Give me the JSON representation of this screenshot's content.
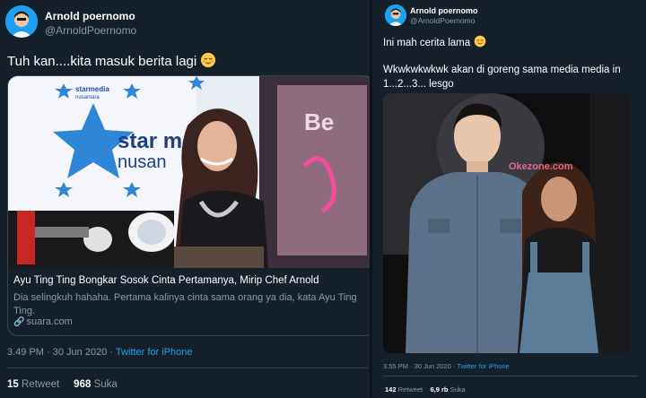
{
  "left_tweet": {
    "display_name": "Arnold poernomo",
    "handle": "@ArnoldPoernomo",
    "text": "Tuh kan....kita masuk berita lagi",
    "emoji": "relieved-face-emoji",
    "card": {
      "title": "Ayu Ting Ting Bongkar Sosok Cinta Pertamanya, Mirip Chef Arnold",
      "description": "Dia selingkuh hahaha. Pertama kalinya cinta sama orang ya dia, kata Ayu Ting Ting.",
      "link_icon": "link-icon",
      "domain": "suara.com",
      "image_text": {
        "brand_top": "starmedia",
        "brand_sub": "nusantara",
        "big_brand": "star m",
        "big_sub": "nusan"
      }
    },
    "time": "3.49 PM",
    "date": "30 Jun 2020",
    "source": "Twitter for iPhone",
    "retweets": "15",
    "retweets_label": "Retweet",
    "likes": "968",
    "likes_label": "Suka"
  },
  "right_tweet": {
    "display_name": "Arnold poernomo",
    "handle": "@ArnoldPoernomo",
    "text_line1": "Ini mah cerita lama",
    "emoji": "relieved-face-emoji",
    "text_line2": "Wkwkwkwkwk akan di goreng sama media media in 1...2...3... lesgo",
    "photo_watermark": "Okezone.com",
    "time": "3.55 PM",
    "date": "30 Jun 2020",
    "source": "Twitter for iPhone",
    "retweets": "142",
    "retweets_label": "Retweet",
    "likes": "6,9 rb",
    "likes_label": "Suka"
  },
  "colors": {
    "background": "#15202b",
    "border": "#38444d",
    "muted_text": "#8899a6",
    "accent": "#1da1f2"
  }
}
